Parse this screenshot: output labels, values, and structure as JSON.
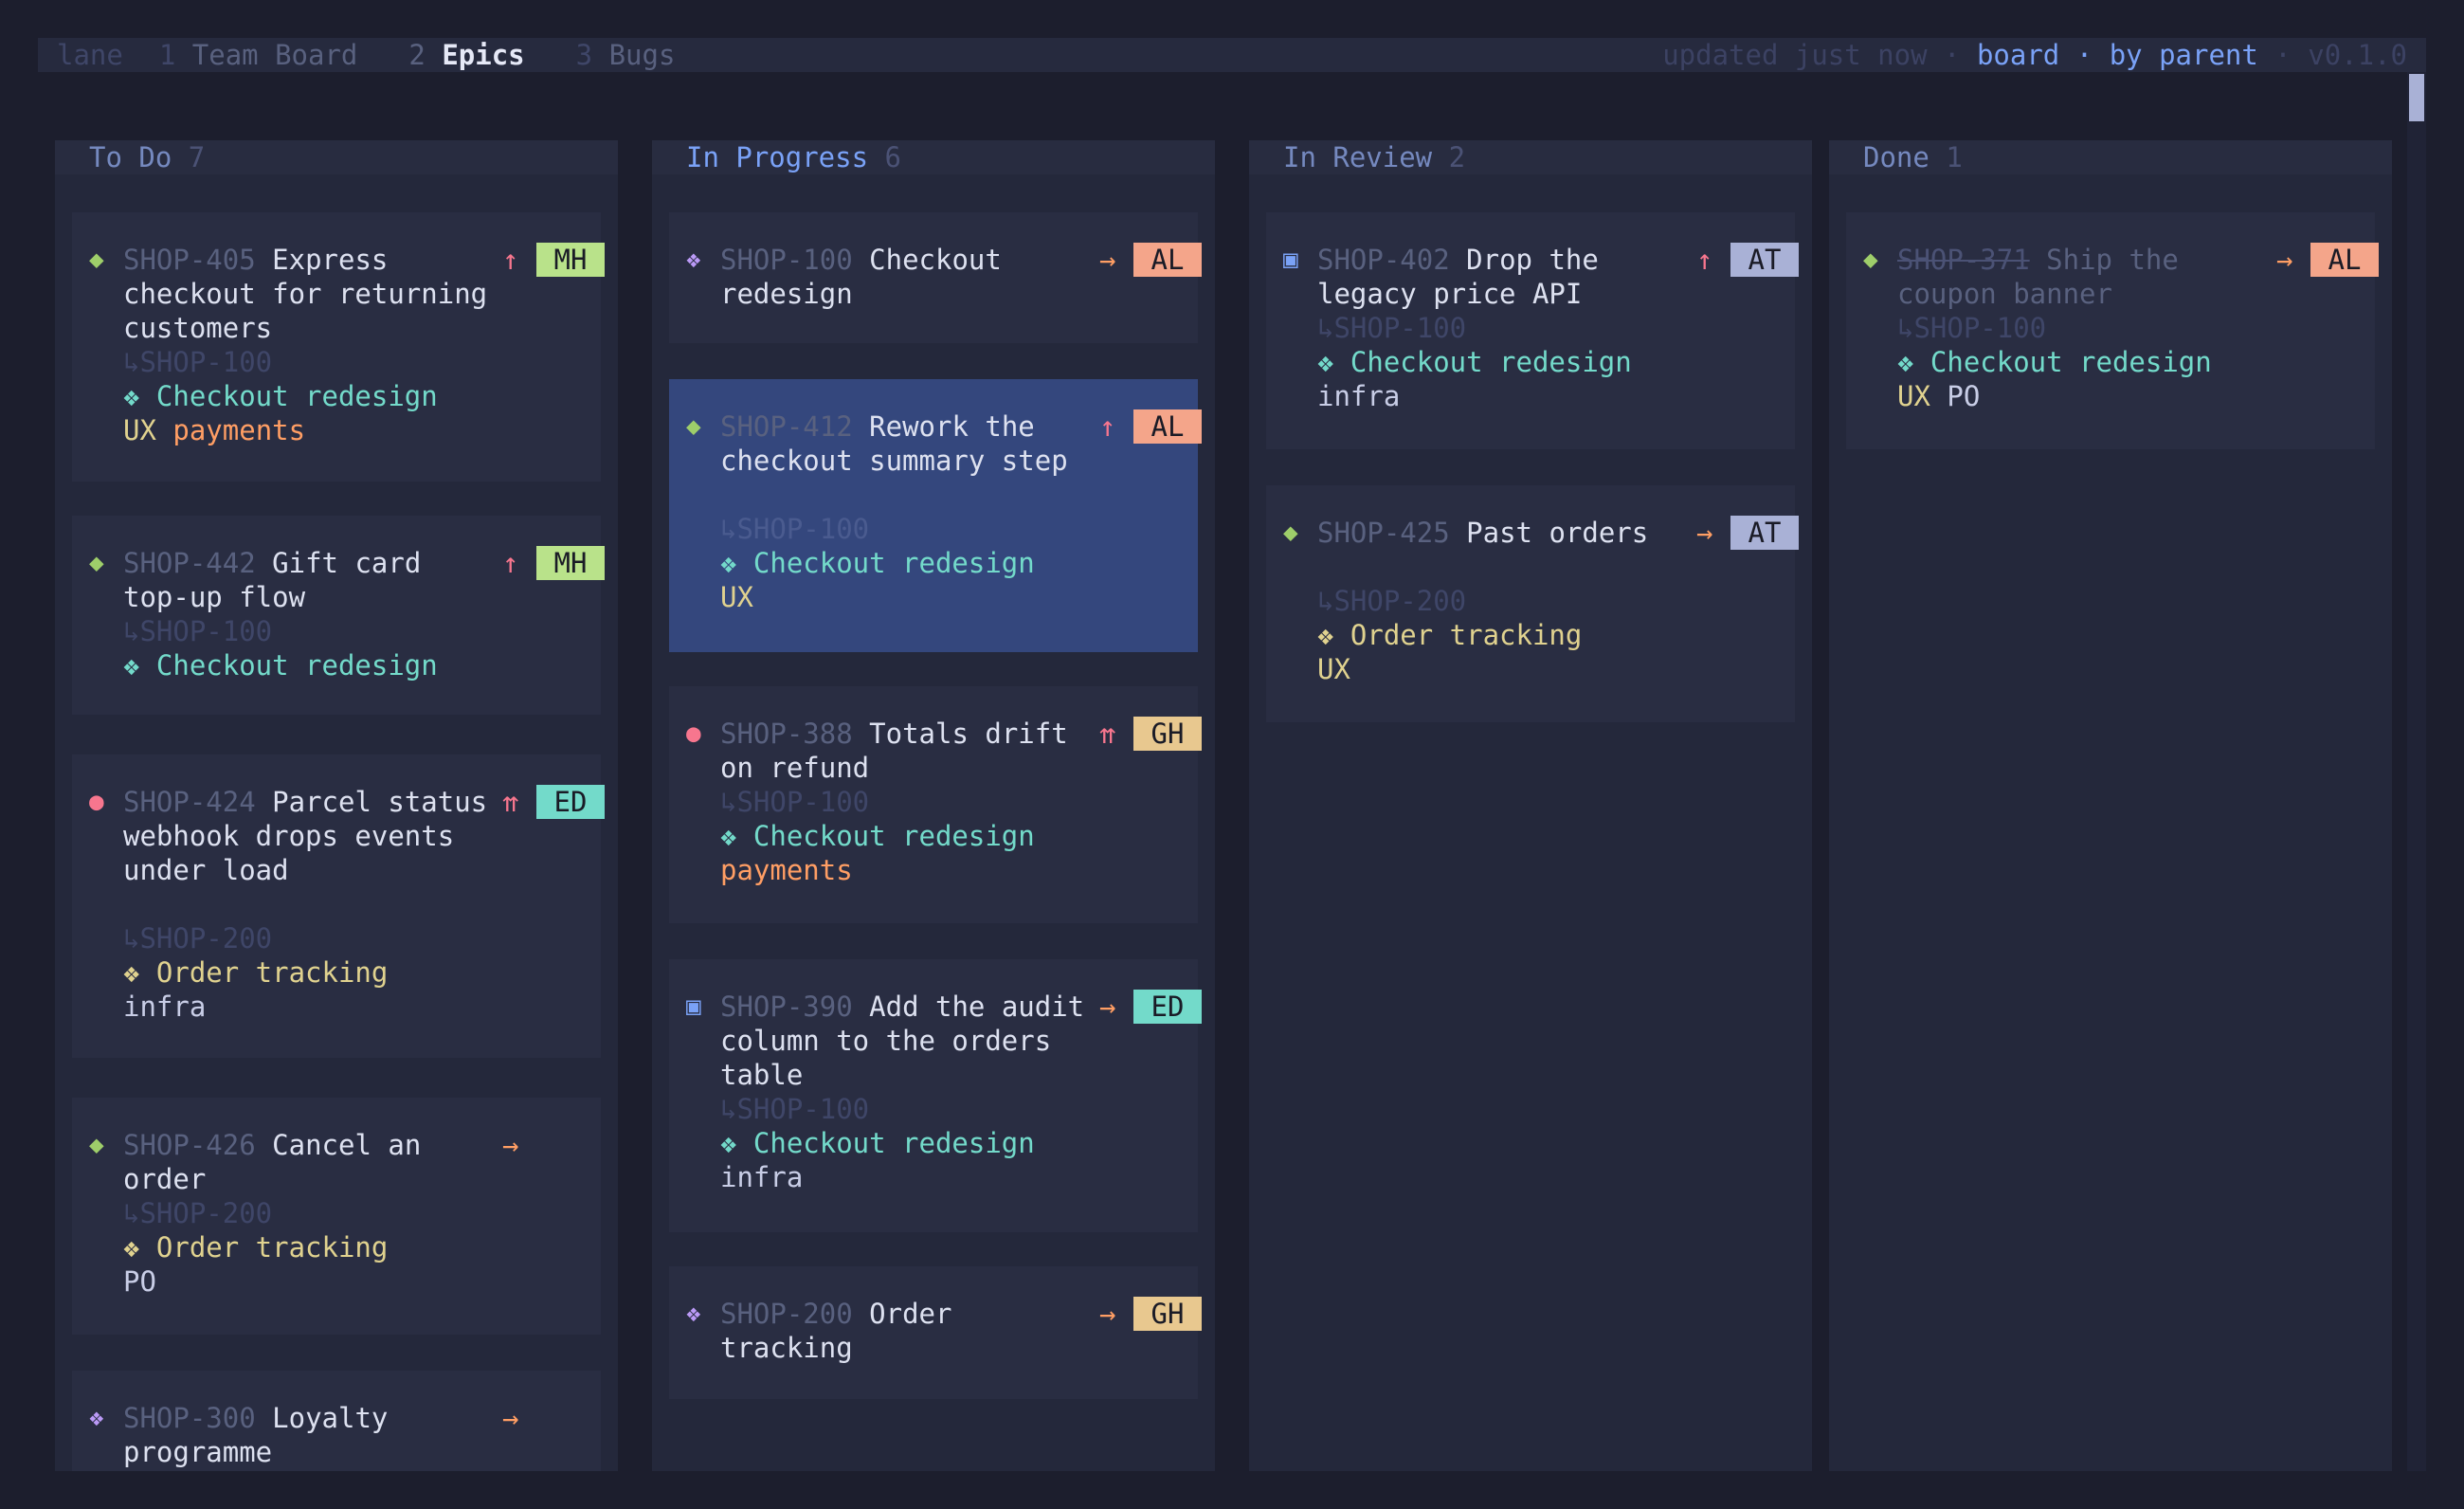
{
  "topbar": {
    "lane_label": "lane",
    "tabs": [
      {
        "num": "1",
        "name": "Team Board"
      },
      {
        "num": "2",
        "name": "Epics"
      },
      {
        "num": "3",
        "name": "Bugs"
      }
    ],
    "status": "updated just now",
    "sep": "·",
    "view": "board",
    "grouping": "by parent",
    "version": "v0.1.0"
  },
  "colors": {
    "background": "#1c1e2d",
    "column": "#24283b",
    "card": "#292d42",
    "selected_card": "#34477d",
    "accent": "#7aa2f7",
    "tag_MH": "#b9e28a",
    "tag_ED": "#73daca",
    "tag_AL": "#f4a58a",
    "tag_GH": "#e8c88f",
    "tag_AT": "#a9b1d6"
  },
  "columns": [
    {
      "title": "To Do",
      "count": "7",
      "cards": [
        {
          "icon": "◆",
          "icon_name": "story-diamond-icon",
          "key": "SHOP-405",
          "title": "Express checkout for returning customers",
          "prio": "↑",
          "assignee": "MH",
          "parent": "↳SHOP-100",
          "epic": "❖ Checkout redesign",
          "labels": [
            "UX",
            "payments"
          ]
        },
        {
          "icon": "◆",
          "icon_name": "story-diamond-icon",
          "key": "SHOP-442",
          "title": "Gift card top-up flow",
          "prio": "↑",
          "assignee": "MH",
          "parent": "↳SHOP-100",
          "epic": "❖ Checkout redesign",
          "labels": []
        },
        {
          "icon": "●",
          "icon_name": "bug-dot-icon",
          "key": "SHOP-424",
          "title": "Parcel status webhook drops events under load",
          "prio": "⇈",
          "assignee": "ED",
          "parent": "↳SHOP-200",
          "epic": "❖ Order tracking",
          "labels": [
            "infra"
          ]
        },
        {
          "icon": "◆",
          "icon_name": "story-diamond-icon",
          "key": "SHOP-426",
          "title": "Cancel an order",
          "prio": "→",
          "assignee": "",
          "parent": "↳SHOP-200",
          "epic": "❖ Order tracking",
          "labels": [
            "PO"
          ]
        },
        {
          "icon": "❖",
          "icon_name": "epic-icon",
          "key": "SHOP-300",
          "title": "Loyalty programme",
          "prio": "→",
          "assignee": "",
          "parent": "",
          "epic": "",
          "labels": []
        }
      ]
    },
    {
      "title": "In Progress",
      "count": "6",
      "cards": [
        {
          "icon": "❖",
          "icon_name": "epic-icon",
          "key": "SHOP-100",
          "title": "Checkout redesign",
          "prio": "→",
          "assignee": "AL",
          "parent": "",
          "epic": "",
          "labels": []
        },
        {
          "icon": "◆",
          "icon_name": "story-diamond-icon",
          "key": "SHOP-412",
          "title": "Rework the checkout summary step",
          "prio": "↑",
          "assignee": "AL",
          "parent": "↳SHOP-100",
          "epic": "❖ Checkout redesign",
          "labels": [
            "UX"
          ]
        },
        {
          "icon": "●",
          "icon_name": "bug-dot-icon",
          "key": "SHOP-388",
          "title": "Totals drift on refund",
          "prio": "⇈",
          "assignee": "GH",
          "parent": "↳SHOP-100",
          "epic": "❖ Checkout redesign",
          "labels": [
            "payments"
          ]
        },
        {
          "icon": "▣",
          "icon_name": "task-square-icon",
          "key": "SHOP-390",
          "title": "Add the audit column to the orders table",
          "prio": "→",
          "assignee": "ED",
          "parent": "↳SHOP-100",
          "epic": "❖ Checkout redesign",
          "labels": [
            "infra"
          ]
        },
        {
          "icon": "❖",
          "icon_name": "epic-icon",
          "key": "SHOP-200",
          "title": "Order tracking",
          "prio": "→",
          "assignee": "GH",
          "parent": "",
          "epic": "",
          "labels": []
        }
      ]
    },
    {
      "title": "In Review",
      "count": "2",
      "cards": [
        {
          "icon": "▣",
          "icon_name": "task-square-icon",
          "key": "SHOP-402",
          "title": "Drop the legacy price API",
          "prio": "↑",
          "assignee": "AT",
          "parent": "↳SHOP-100",
          "epic": "❖ Checkout redesign",
          "labels": [
            "infra"
          ]
        },
        {
          "icon": "◆",
          "icon_name": "story-diamond-icon",
          "key": "SHOP-425",
          "title": "Past orders",
          "prio": "→",
          "assignee": "AT",
          "parent": "↳SHOP-200",
          "epic": "❖ Order tracking",
          "labels": [
            "UX"
          ]
        }
      ]
    },
    {
      "title": "Done",
      "count": "1",
      "cards": [
        {
          "icon": "◆",
          "icon_name": "story-diamond-icon",
          "key": "SHOP-371",
          "title": "Ship the coupon banner",
          "prio": "→",
          "assignee": "AL",
          "parent": "↳SHOP-100",
          "epic": "❖ Checkout redesign",
          "labels": [
            "UX",
            "PO"
          ]
        }
      ]
    }
  ]
}
